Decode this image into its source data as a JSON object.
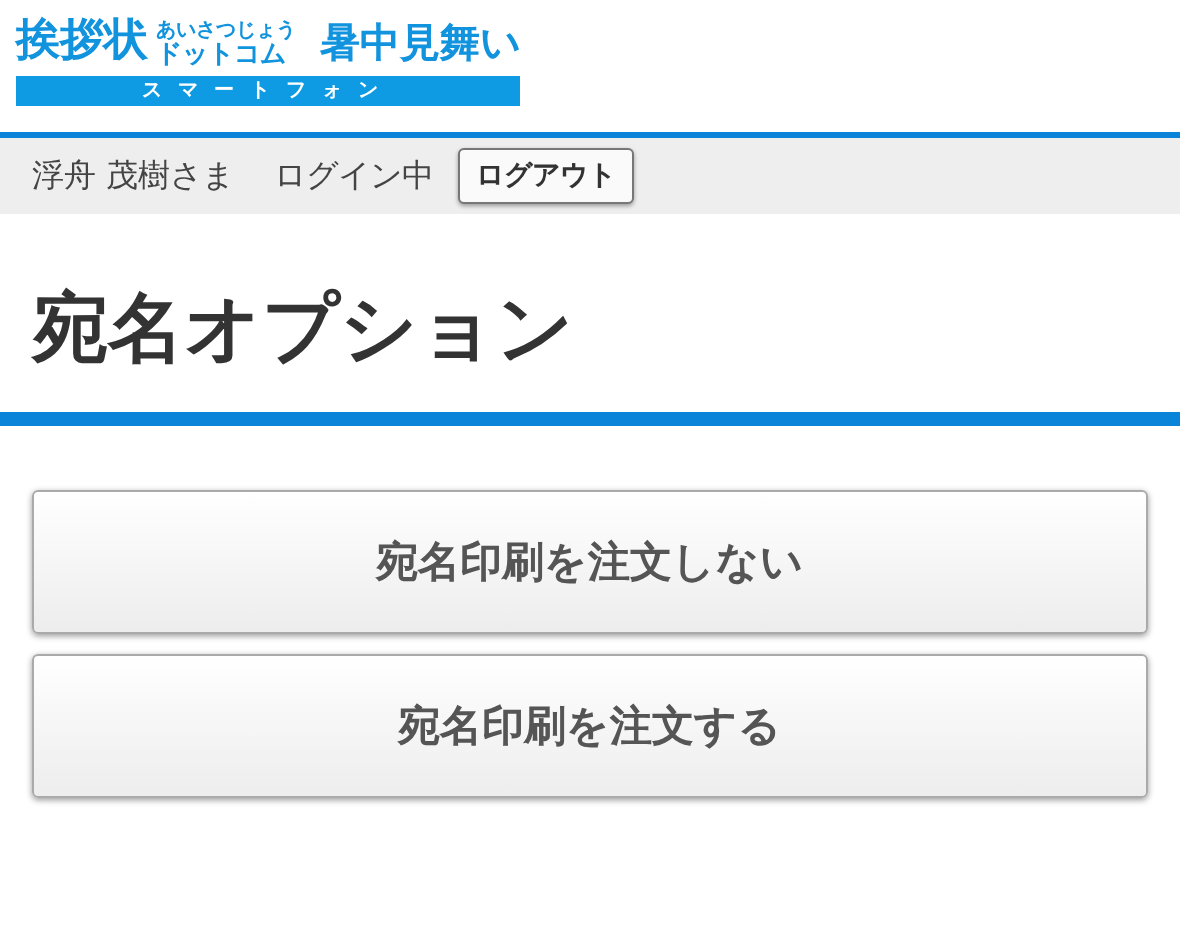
{
  "logo": {
    "main": "挨拶状",
    "ruby": "あいさつじょう",
    "sub": "ドットコム",
    "product": "暑中見舞い",
    "bar": "スマートフォン"
  },
  "user_bar": {
    "user": "浮舟 茂樹さま",
    "status": "ログイン中",
    "logout": "ログアウト"
  },
  "page_title": "宛名オプション",
  "buttons": [
    "宛名印刷を注文しない",
    "宛名印刷を注文する"
  ]
}
